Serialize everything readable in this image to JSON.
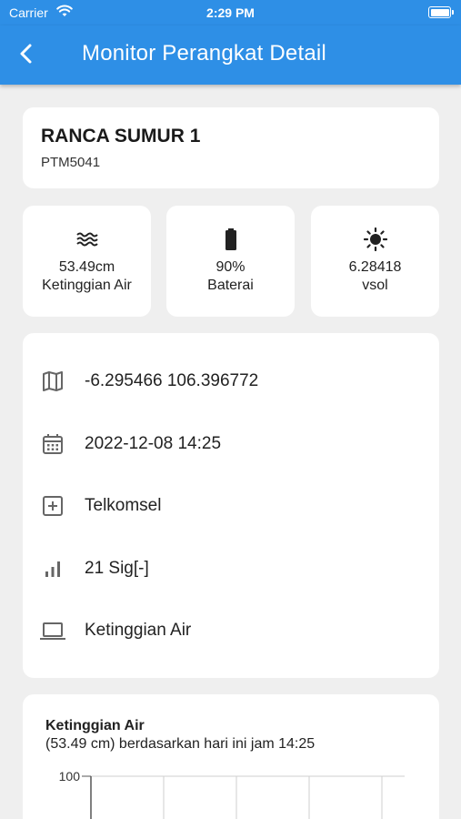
{
  "status_bar": {
    "carrier": "Carrier",
    "time": "2:29 PM"
  },
  "app_bar": {
    "title": "Monitor Perangkat Detail"
  },
  "device": {
    "name": "RANCA SUMUR 1",
    "code": "PTM5041"
  },
  "stats": [
    {
      "icon": "water-waves-icon",
      "value": "53.49cm",
      "label": "Ketinggian Air"
    },
    {
      "icon": "battery-icon",
      "value": "90%",
      "label": "Baterai"
    },
    {
      "icon": "sun-icon",
      "value": "6.28418",
      "label": "vsol"
    }
  ],
  "info": [
    {
      "icon": "map-icon",
      "text": "-6.295466 106.396772"
    },
    {
      "icon": "calendar-icon",
      "text": "2022-12-08 14:25"
    },
    {
      "icon": "plus-box-icon",
      "text": "Telkomsel"
    },
    {
      "icon": "signal-icon",
      "text": "21 Sig[-]"
    },
    {
      "icon": "laptop-icon",
      "text": "Ketinggian Air"
    }
  ],
  "chart": {
    "title": "Ketinggian Air",
    "subtitle": "(53.49 cm) berdasarkan hari ini jam 14:25"
  },
  "chart_data": {
    "type": "line",
    "title": "Ketinggian Air",
    "subtitle": "(53.49 cm) berdasarkan hari ini jam 14:25",
    "y_tick_labels": [
      "100"
    ],
    "ylim_max": 100,
    "grid": true,
    "series": []
  },
  "colors": {
    "primary": "#2e8fe6",
    "background": "#efefef",
    "card": "#ffffff",
    "icon": "#666666"
  }
}
